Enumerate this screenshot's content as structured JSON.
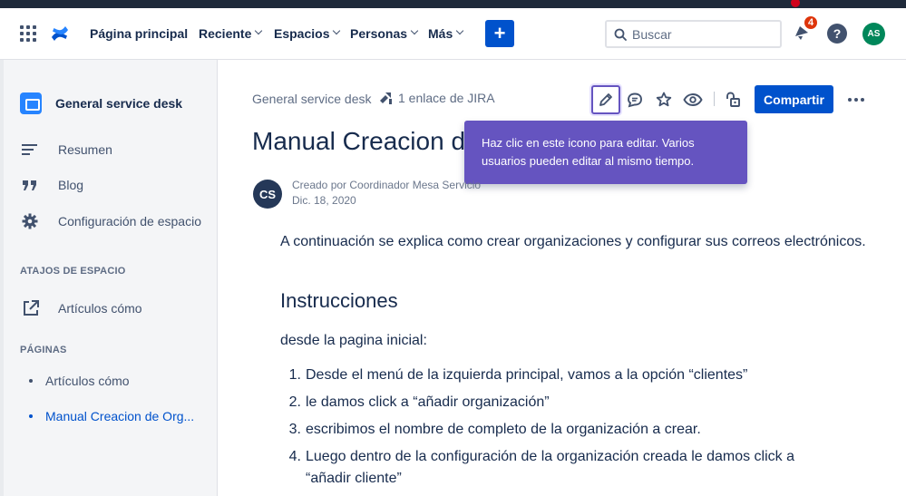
{
  "header": {
    "nav": {
      "home": "Página principal",
      "recent": "Reciente",
      "spaces": "Espacios",
      "people": "Personas",
      "more": "Más"
    },
    "create_label": "+",
    "search_placeholder": "Buscar",
    "notification_count": "4",
    "help_label": "?",
    "user_initials": "AS",
    "icons": [
      "apps-grid-icon",
      "confluence-logo-icon",
      "search-icon",
      "notification-icon",
      "help-icon"
    ]
  },
  "sidebar": {
    "space_name": "General service desk",
    "items": [
      {
        "label": "Resumen",
        "icon": "summary-icon"
      },
      {
        "label": "Blog",
        "icon": "quote-icon"
      },
      {
        "label": "Configuración de espacio",
        "icon": "gear-icon"
      }
    ],
    "shortcuts_title": "ATAJOS DE ESPACIO",
    "shortcuts": [
      {
        "label": "Artículos cómo",
        "icon": "external-link-icon"
      }
    ],
    "pages_title": "PÁGINAS",
    "pages": [
      {
        "label": "Artículos cómo",
        "selected": false
      },
      {
        "label": "Manual Creacion de Org...",
        "selected": true
      }
    ]
  },
  "page": {
    "breadcrumb": "General service desk",
    "jira_links": "1 enlace de JIRA",
    "share_label": "Compartir",
    "tooltip": "Haz clic en este icono para editar. Varios usuarios pueden editar al mismo tiempo.",
    "title": "Manual Creacion de",
    "author_initials": "CS",
    "created_by": "Creado por Coordinador Mesa Servicio",
    "created_date": "Dic. 18, 2020",
    "intro": "A continuación se explica como crear organizaciones y configurar sus correos electrónicos.",
    "heading": "Instrucciones",
    "subheading": "desde la pagina inicial:",
    "steps": [
      "Desde el menú de la izquierda principal, vamos a la opción “clientes”",
      "le damos click a “añadir organización”",
      "escribimos el nombre de completo de la organización a crear.",
      "Luego dentro de la configuración de la organización creada le damos click a “añadir cliente”"
    ],
    "step_numbers": [
      "1.",
      "2.",
      "3.",
      "4."
    ]
  },
  "colors": {
    "primary": "#0052cc",
    "tooltip": "#6554c0",
    "badge": "#de350b",
    "user_avatar": "#00875a"
  }
}
